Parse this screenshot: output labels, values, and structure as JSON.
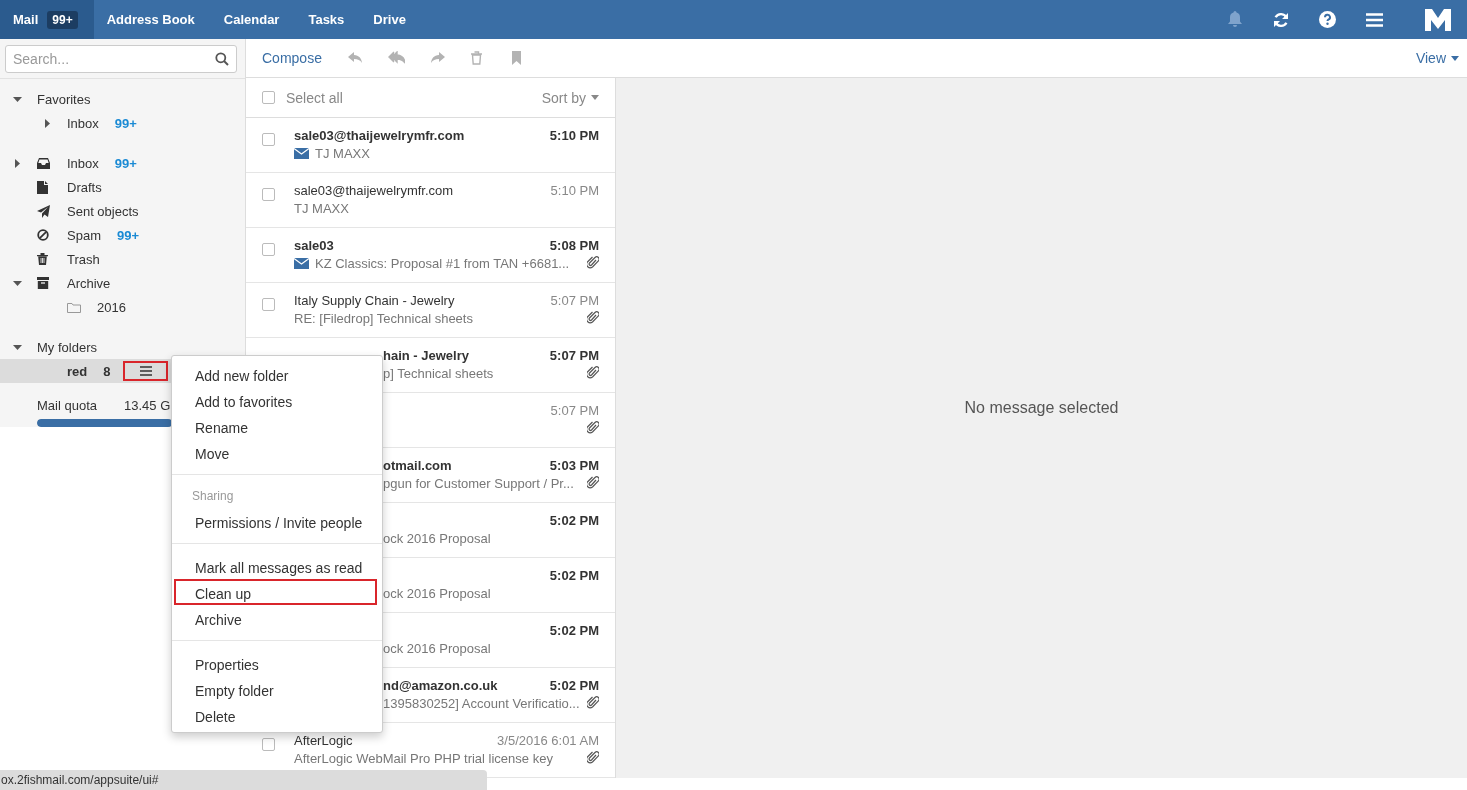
{
  "top_bar": {
    "tabs": [
      {
        "label": "Mail",
        "badge": "99+",
        "selected": true
      },
      {
        "label": "Address Book",
        "selected": false
      },
      {
        "label": "Calendar",
        "selected": false
      },
      {
        "label": "Tasks",
        "selected": false
      },
      {
        "label": "Drive",
        "selected": false
      }
    ]
  },
  "sidebar": {
    "search": {
      "placeholder": "Search..."
    },
    "tree": [
      {
        "label": "Favorites",
        "kind": "section",
        "expanded": true,
        "children": [
          {
            "label": "Inbox",
            "kind": "plain",
            "expanded": false,
            "count": "99+",
            "selected": false
          }
        ]
      },
      {
        "label": "Inbox",
        "kind": "inbox",
        "expanded": false,
        "count": "99+",
        "selected": false
      },
      {
        "label": "Drafts",
        "kind": "drafts",
        "selected": false
      },
      {
        "label": "Sent objects",
        "kind": "sent",
        "selected": false
      },
      {
        "label": "Spam",
        "kind": "spam",
        "count": "99+",
        "selected": false
      },
      {
        "label": "Trash",
        "kind": "trash",
        "selected": false
      },
      {
        "label": "Archive",
        "kind": "archive",
        "expanded": true,
        "selected": false,
        "children": [
          {
            "label": "2016",
            "kind": "folder",
            "selected": false
          }
        ]
      },
      {
        "label": "My folders",
        "kind": "section",
        "expanded": true,
        "children": [
          {
            "label": "red",
            "kind": "plain",
            "count": "8",
            "selected": true,
            "menu_button": {
              "highlighted": true
            }
          }
        ]
      }
    ],
    "quota": {
      "label": "Mail quota",
      "value": "13.45 G",
      "level": 0.75
    }
  },
  "toolbar": {
    "compose": "Compose",
    "actions": [
      {
        "kind": "reply",
        "disabled": true
      },
      {
        "kind": "reply-all",
        "disabled": true
      },
      {
        "kind": "forward",
        "disabled": true
      },
      {
        "kind": "delete",
        "disabled": true
      },
      {
        "kind": "bookmark",
        "disabled": true
      }
    ],
    "view": "View"
  },
  "message_list": {
    "select_all": {
      "label": "Select all",
      "checked": false
    },
    "sort": "Sort by",
    "messages": [
      {
        "sender": "sale03@thaijewelrymfr.com",
        "subject": "TJ MAXX",
        "time": "5:10 PM",
        "unread": true,
        "attachment": false,
        "covered": false
      },
      {
        "sender": "sale03@thaijewelrymfr.com",
        "subject": "TJ MAXX",
        "time": "5:10 PM",
        "unread": false,
        "attachment": false,
        "covered": false
      },
      {
        "sender": "sale03",
        "subject": "KZ Classics: Proposal #1 from TAN +6681...",
        "time": "5:08 PM",
        "unread": true,
        "attachment": true,
        "covered": false
      },
      {
        "sender": "Italy Supply Chain - Jewelry",
        "subject": "RE: [Filedrop] Technical sheets",
        "time": "5:07 PM",
        "unread": false,
        "attachment": true,
        "covered": false
      },
      {
        "sender": "hain - Jewelry",
        "subject": "p] Technical sheets",
        "time": "5:07 PM",
        "unread": true,
        "attachment": true,
        "covered": true
      },
      {
        "time": "5:07 PM",
        "unread": false,
        "attachment": true,
        "covered": true
      },
      {
        "sender": "otmail.com",
        "subject": "pgun for Customer Support / Pr...",
        "time": "5:03 PM",
        "unread": true,
        "attachment": true,
        "covered": true
      },
      {
        "subject": "ock 2016 Proposal",
        "time": "5:02 PM",
        "unread": true,
        "attachment": false,
        "covered": true
      },
      {
        "subject": "ock 2016 Proposal",
        "time": "5:02 PM",
        "unread": true,
        "attachment": false,
        "covered": true
      },
      {
        "subject": "ock 2016 Proposal",
        "time": "5:02 PM",
        "unread": true,
        "attachment": false,
        "covered": true
      },
      {
        "sender": "nd@amazon.co.uk",
        "subject": "1395830252] Account Verificatio...",
        "time": "5:02 PM",
        "unread": true,
        "attachment": true,
        "covered": true
      },
      {
        "sender": "AfterLogic",
        "subject": "AfterLogic WebMail Pro PHP trial license key",
        "time": "3/5/2016 6:01 AM",
        "unread": false,
        "attachment": true,
        "covered": false
      }
    ]
  },
  "reading_pane": {
    "empty_text": "No message selected"
  },
  "context_menu": {
    "groups": [
      [
        {
          "label": "Add new folder",
          "kind": "item",
          "highlighted": false
        },
        {
          "label": "Add to favorites",
          "kind": "item",
          "highlighted": false
        },
        {
          "label": "Rename",
          "kind": "item",
          "highlighted": false
        },
        {
          "label": "Move",
          "kind": "item",
          "highlighted": false
        }
      ],
      [
        {
          "label": "Sharing",
          "kind": "header"
        },
        {
          "label": "Permissions / Invite people",
          "kind": "item",
          "highlighted": false
        }
      ],
      [
        {
          "label": "Mark all messages as read",
          "kind": "item",
          "highlighted": false
        },
        {
          "label": "Clean up",
          "kind": "item",
          "highlighted": true
        },
        {
          "label": "Archive",
          "kind": "item",
          "highlighted": false
        }
      ],
      [
        {
          "label": "Properties",
          "kind": "item",
          "highlighted": false
        },
        {
          "label": "Empty folder",
          "kind": "item",
          "highlighted": false
        },
        {
          "label": "Delete",
          "kind": "item",
          "highlighted": false
        }
      ]
    ]
  },
  "status_url": "ox.2fishmail.com/appsuite/ui#"
}
